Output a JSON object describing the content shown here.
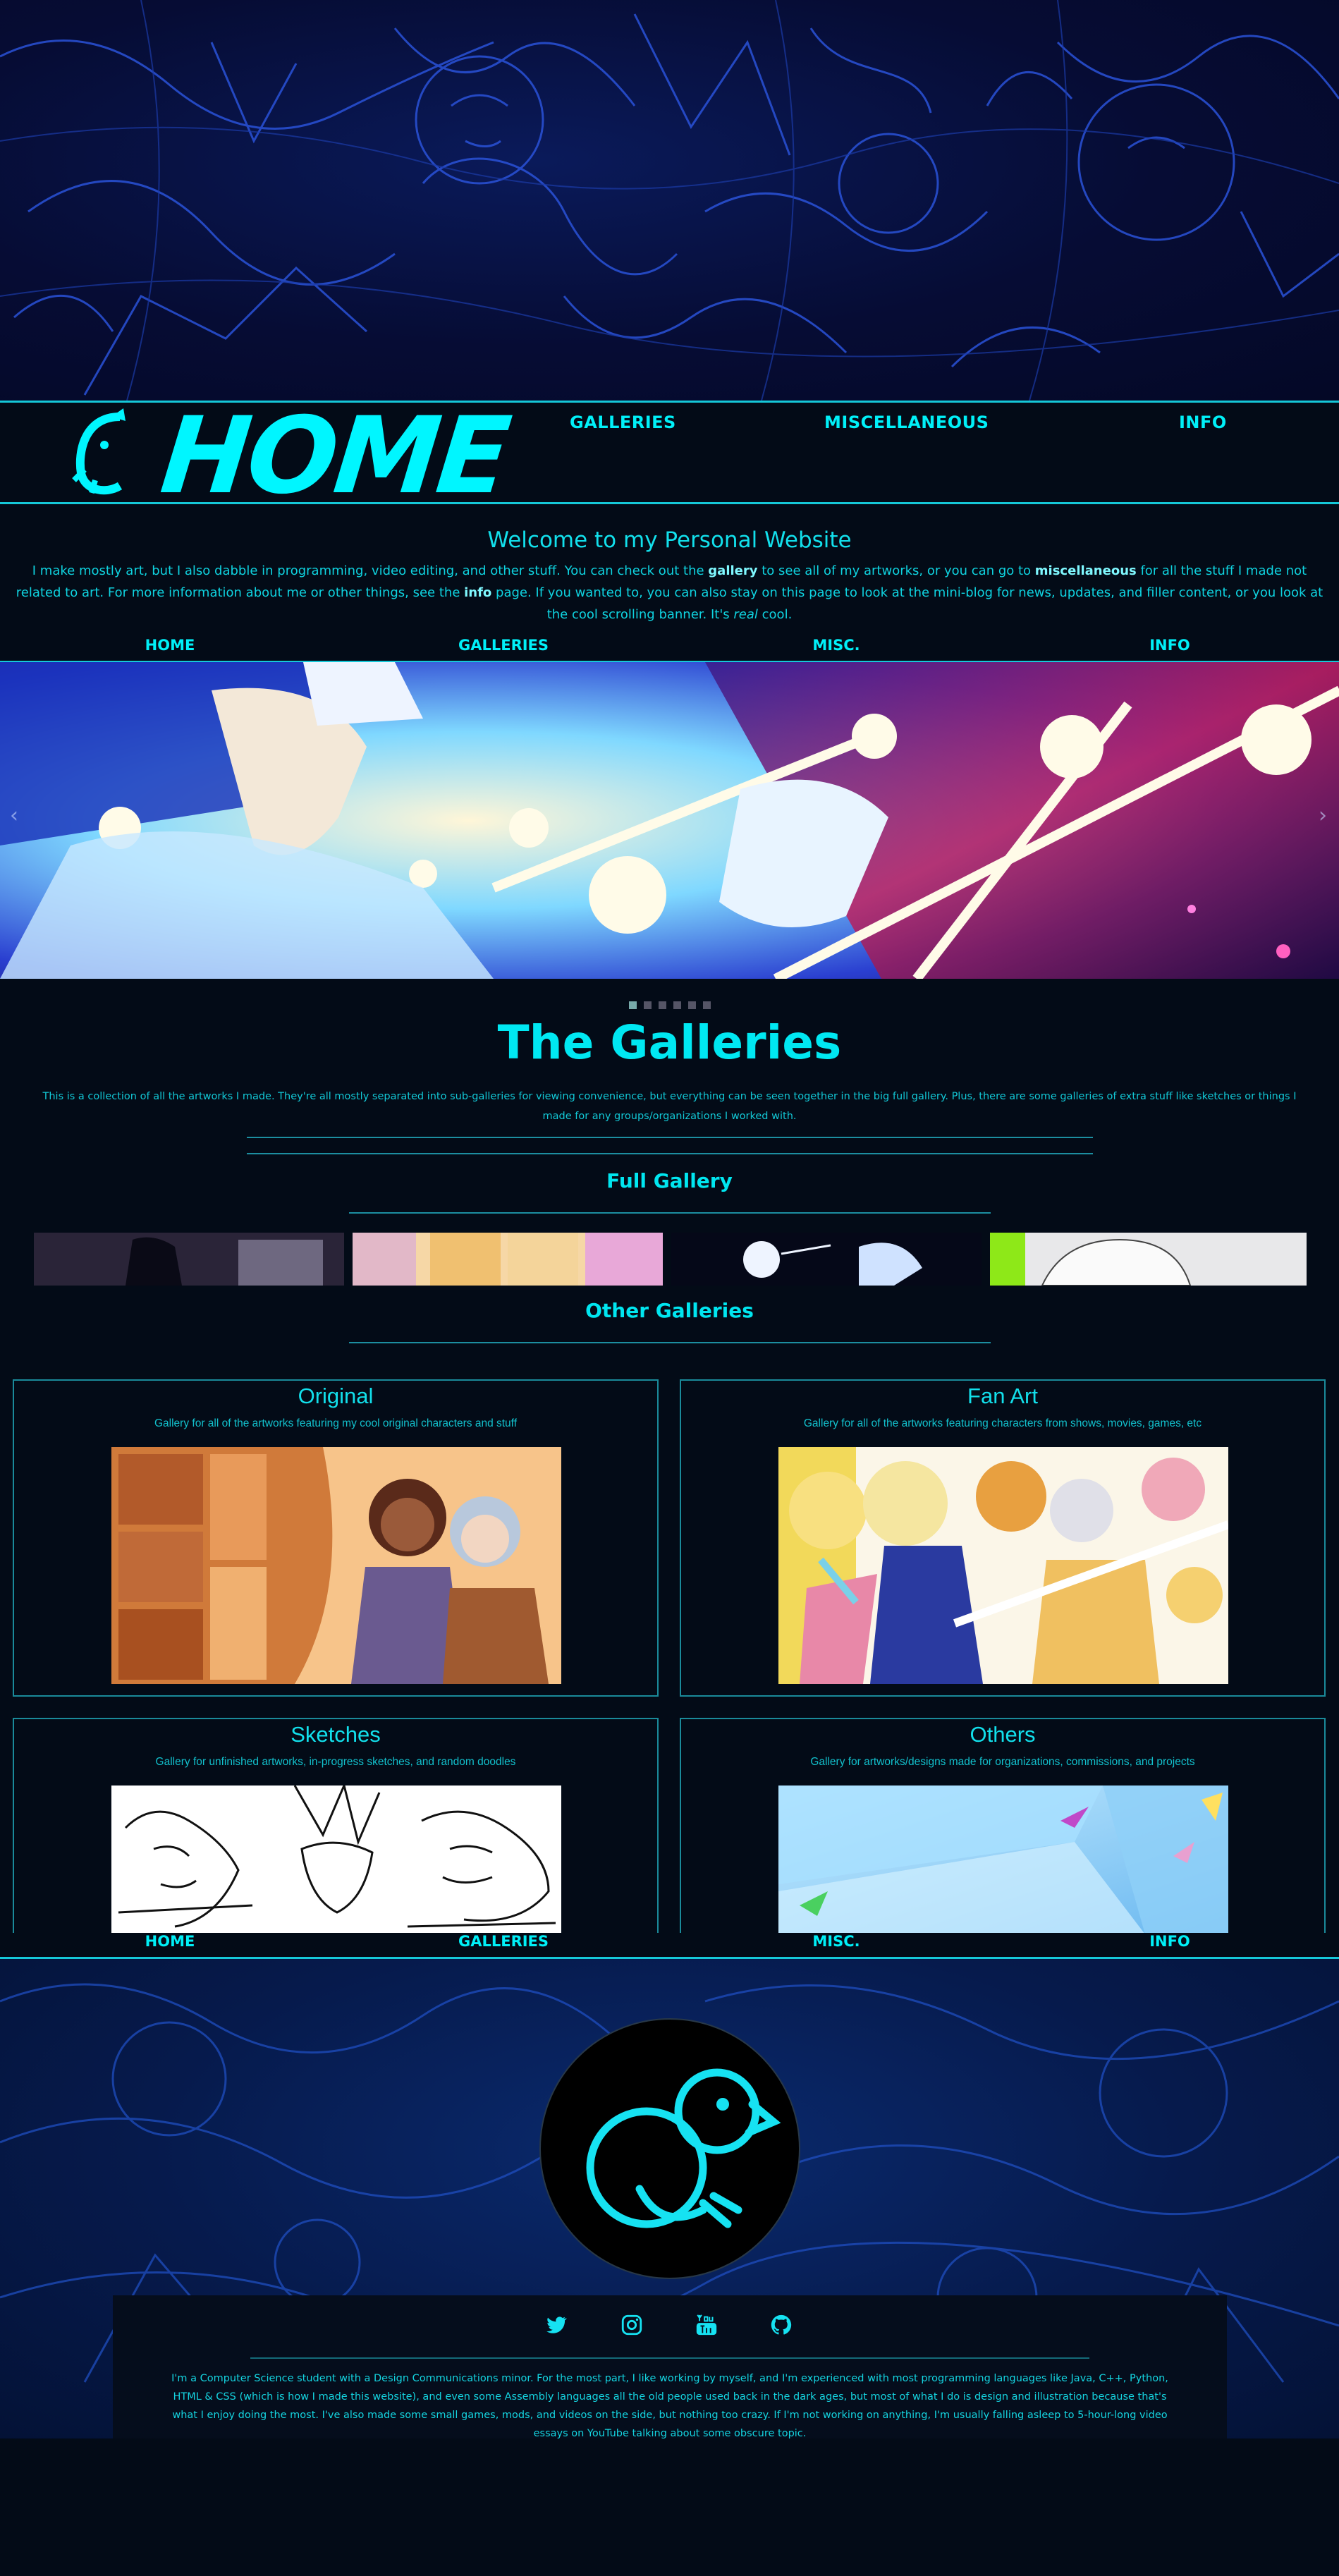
{
  "header": {
    "logo_text": "HOME",
    "nav": [
      "GALLERIES",
      "MISCELLANEOUS",
      "INFO"
    ]
  },
  "welcome": {
    "title": "Welcome to my Personal Website",
    "p1": "I make mostly art, but I also dabble in programming, video editing, and other stuff. You can check out the ",
    "link_gallery": "gallery",
    "p2": " to see all of my artworks, or you can go to ",
    "link_misc": "miscellaneous",
    "p3": " for all the stuff I made not related to art. For more information about me or other things, see the ",
    "link_info": "info",
    "p4": " page. If you wanted to, you can also stay on this page to look at the mini-blog for news, updates, and filler content, or you look at the cool scrolling banner. It's ",
    "em_real": "real",
    "p5": " cool."
  },
  "subnav": [
    "HOME",
    "GALLERIES",
    "MISC.",
    "INFO"
  ],
  "carousel": {
    "slide_count": 6,
    "active_index": 0,
    "prev": "‹",
    "next": "›"
  },
  "galleries": {
    "title": "The Galleries",
    "description": "This is a collection of all the artworks I made. They're all mostly separated into sub-galleries for viewing convenience, but everything can be seen together in the big full gallery. Plus, there are some galleries of extra stuff like sketches or things I made for any groups/organizations I worked with.",
    "full_title": "Full Gallery",
    "other_title": "Other Galleries",
    "cards": [
      {
        "title": "Original",
        "desc": "Gallery for all of the artworks featuring my cool original characters and stuff"
      },
      {
        "title": "Fan Art",
        "desc": "Gallery for all of the artworks featuring characters from shows, movies, games, etc"
      },
      {
        "title": "Sketches",
        "desc": "Gallery for unfinished artworks, in-progress sketches, and random doodles"
      },
      {
        "title": "Others",
        "desc": "Gallery for artworks/designs made for organizations, commissions, and projects"
      }
    ]
  },
  "footer": {
    "social": [
      "twitter-icon",
      "instagram-icon",
      "youtube-icon",
      "github-icon"
    ],
    "bio": "I'm a Computer Science student with a Design Communications minor. For the most part, I like working by myself, and I'm experienced with most programming languages like Java, C++, Python, HTML & CSS (which is how I made this website), and even some Assembly languages all the old people used back in the dark ages, but most of what I do is design and illustration because that's what I enjoy doing the most. I've also made some small games, mods, and videos on the side, but nothing too crazy. If I'm not working on anything, I'm usually falling asleep to 5-hour-long video essays on YouTube talking about some obscure topic."
  },
  "colors": {
    "accent": "#00f0f8",
    "background": "#030b17",
    "line": "#15c8d8"
  }
}
